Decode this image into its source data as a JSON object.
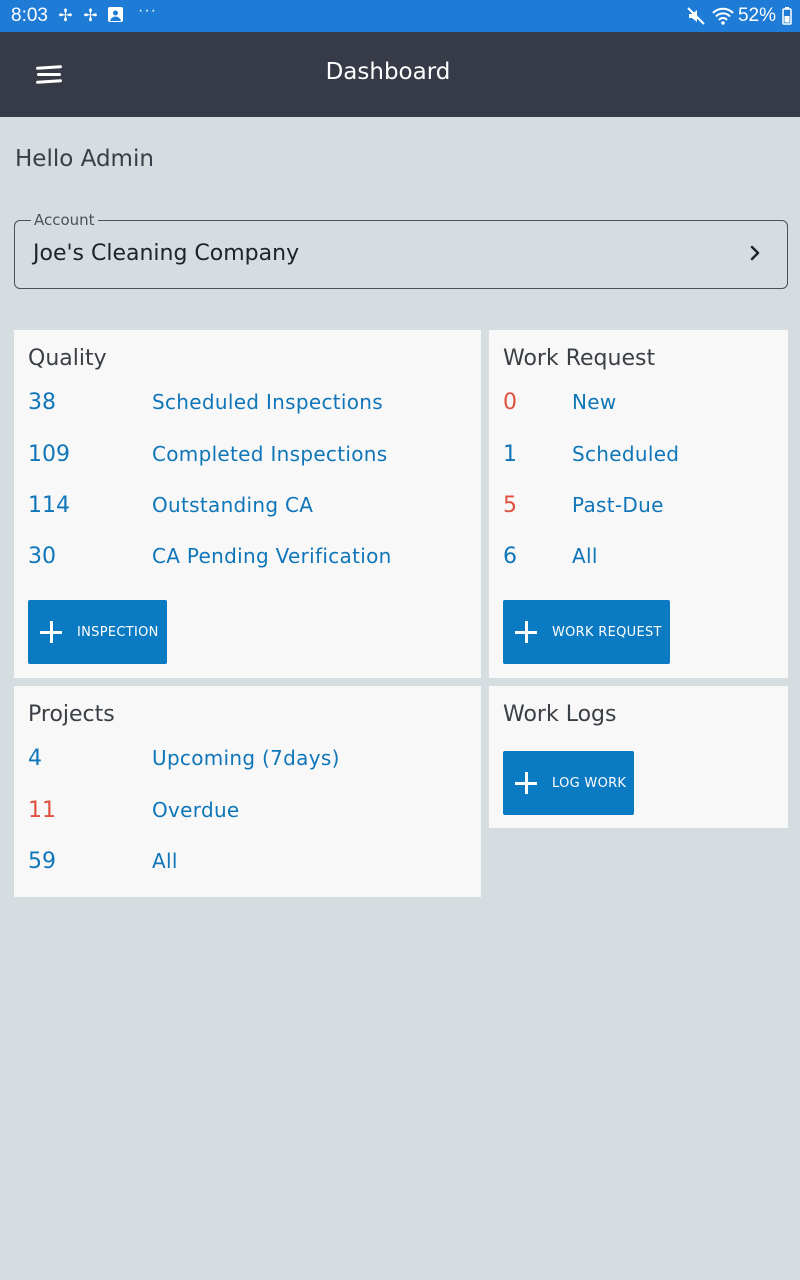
{
  "status_bar": {
    "time": "8:03",
    "more": "···",
    "battery": "52%",
    "icons": [
      "pinwheel-icon",
      "pinwheel-icon",
      "image-icon",
      "mute-icon",
      "wifi-icon",
      "battery-icon"
    ]
  },
  "app_bar": {
    "title": "Dashboard",
    "menu_icon": "hamburger-menu-icon"
  },
  "greeting": "Hello Admin",
  "account": {
    "label": "Account",
    "value": "Joe's Cleaning Company",
    "icon": "chevron-right-icon"
  },
  "colors": {
    "accent": "#0a7bc2",
    "link": "#0f76b9",
    "alert": "#e0523f",
    "app_bar": "#363b47",
    "status_bar": "#1e7bd6",
    "background": "#d5dde0"
  },
  "quality": {
    "title": "Quality",
    "items": [
      {
        "count": "38",
        "label": "Scheduled Inspections"
      },
      {
        "count": "109",
        "label": "Completed Inspections"
      },
      {
        "count": "114",
        "label": "Outstanding CA"
      },
      {
        "count": "30",
        "label": "CA Pending Verification"
      }
    ],
    "button": "INSPECTION"
  },
  "work_request": {
    "title": "Work Request",
    "items": [
      {
        "count": "0",
        "label": "New",
        "alert": true
      },
      {
        "count": "1",
        "label": "Scheduled",
        "alert": false
      },
      {
        "count": "5",
        "label": "Past-Due",
        "alert": true
      },
      {
        "count": "6",
        "label": "All",
        "alert": false
      }
    ],
    "button": "WORK REQUEST"
  },
  "projects": {
    "title": "Projects",
    "items": [
      {
        "count": "4",
        "label": "Upcoming (7days)",
        "alert": false
      },
      {
        "count": "11",
        "label": "Overdue",
        "alert": true
      },
      {
        "count": "59",
        "label": "All",
        "alert": false
      }
    ]
  },
  "work_logs": {
    "title": "Work Logs",
    "button": "LOG WORK"
  }
}
